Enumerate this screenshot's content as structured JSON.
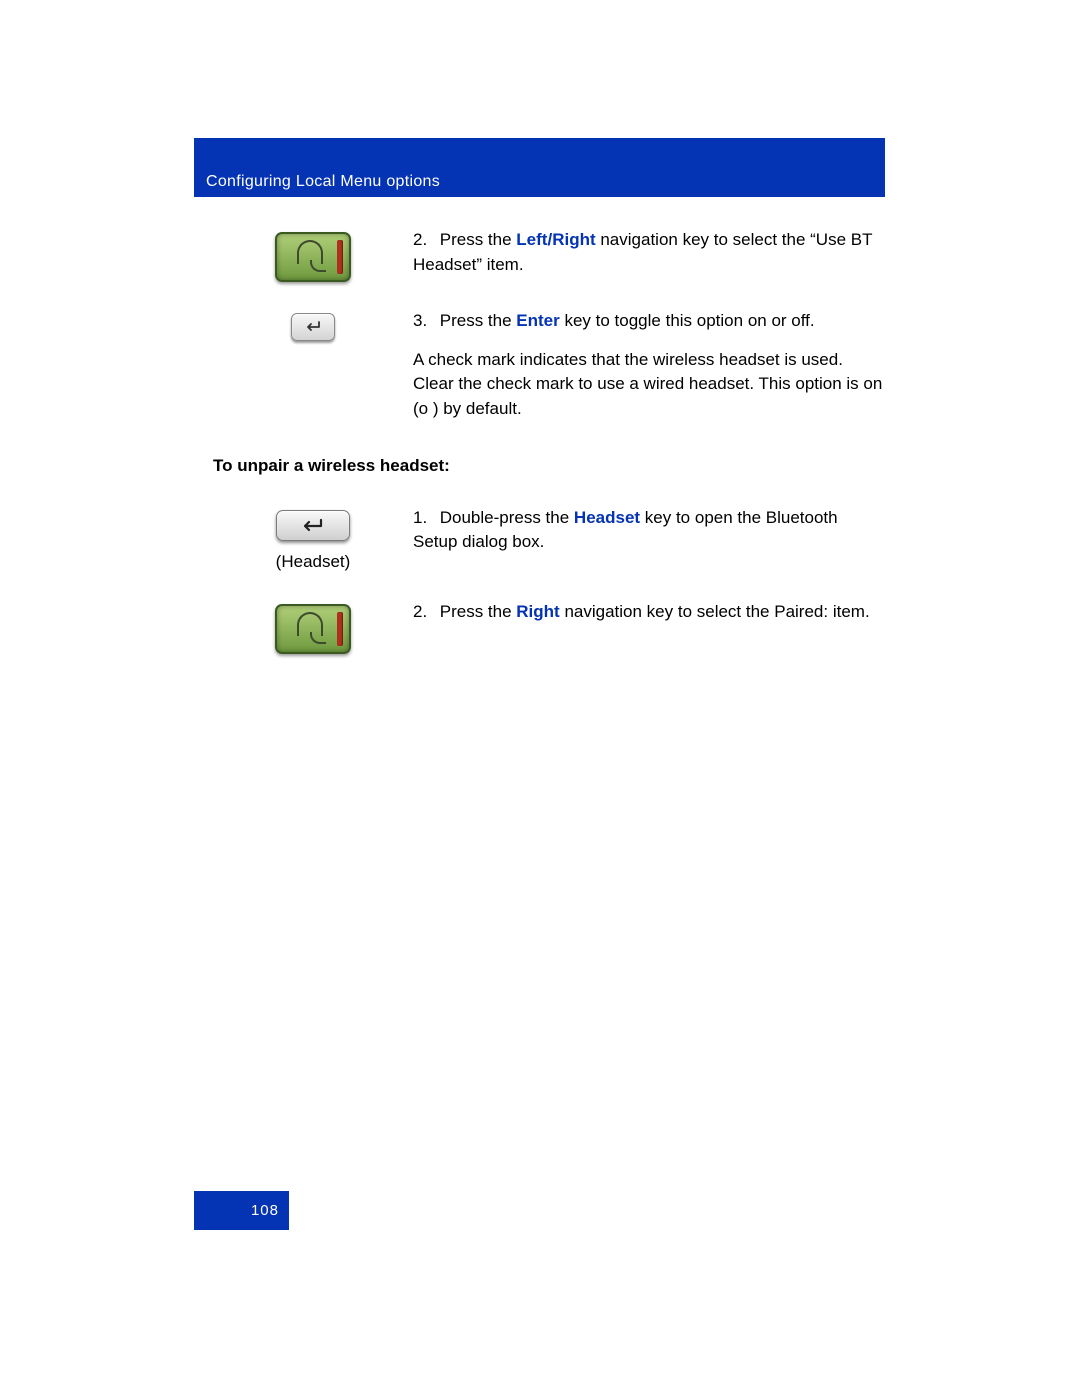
{
  "header": {
    "title": "Configuring Local Menu options"
  },
  "footer": {
    "page_number": "108"
  },
  "accent_color": "#0433b3",
  "steps_a": {
    "s2": {
      "num": "2.",
      "pre": "Press the ",
      "k1": "Left",
      "slash": "/",
      "k2": "Right",
      "post": " navigation key to select the “Use BT Headset” item."
    },
    "s3": {
      "num": "3.",
      "pre": "Press the ",
      "k1": "Enter",
      "post": " key to toggle this option on or off.",
      "extra": "A check mark indicates that the wireless headset is used. Clear the check mark to use a wired headset. This option is on (o ) by default."
    }
  },
  "section": {
    "title": "To unpair a wireless headset:"
  },
  "steps_b": {
    "s1": {
      "num": "1.",
      "pre": "Double-press the ",
      "k1": "Headset",
      "post": " key to open the Bluetooth Setup dialog box.",
      "icon_label": "(Headset)"
    },
    "s2": {
      "num": "2.",
      "pre": "Press the ",
      "k1": "Right",
      "post": " navigation key to select the Paired: item."
    }
  }
}
